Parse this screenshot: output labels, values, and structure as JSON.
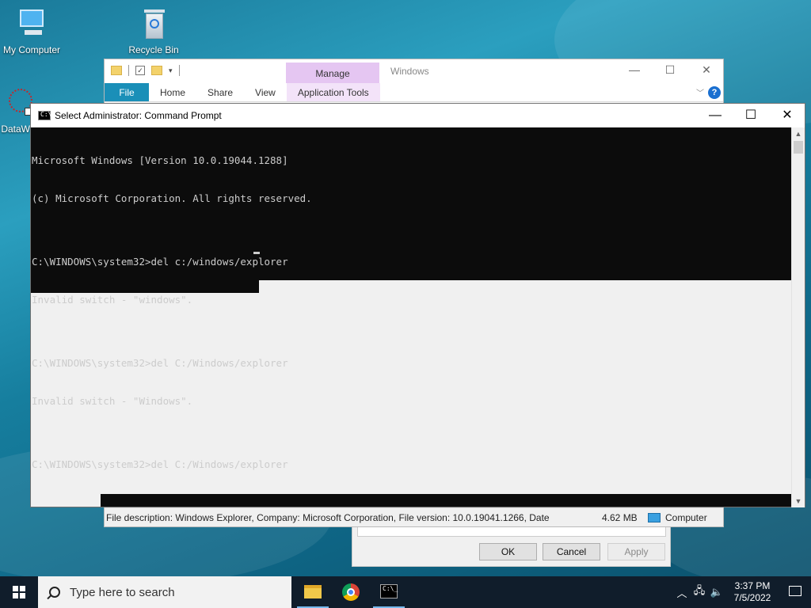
{
  "desktop": {
    "icons": [
      {
        "label": "My Computer"
      },
      {
        "label": "Recycle Bin"
      },
      {
        "label": "DataW"
      }
    ]
  },
  "explorer": {
    "title": "Windows",
    "manage_tab": "Manage",
    "ribbon_tabs": [
      "File",
      "Home",
      "Share",
      "View",
      "Application Tools"
    ],
    "status_description": "File description: Windows Explorer, Company: Microsoft Corporation, File version: 10.0.19041.1266, Date",
    "status_size": "4.62 MB",
    "status_location": "Computer",
    "help_symbol": "?"
  },
  "properties_dialog": {
    "ok": "OK",
    "cancel": "Cancel",
    "apply": "Apply"
  },
  "cmd": {
    "title": "Select Administrator: Command Prompt",
    "icon_text": "C:\\",
    "lines": [
      "Microsoft Windows [Version 10.0.19044.1288]",
      "(c) Microsoft Corporation. All rights reserved.",
      "",
      "C:\\WINDOWS\\system32>del c:/windows/explorer",
      "Invalid switch - \"windows\".",
      "",
      "C:\\WINDOWS\\system32>del C:/Windows/explorer",
      "Invalid switch - \"Windows\".",
      "",
      "C:\\WINDOWS\\system32>del C:/Windows/explorer"
    ]
  },
  "taskbar": {
    "search_placeholder": "Type here to search",
    "time": "3:37 PM",
    "date": "7/5/2022"
  }
}
